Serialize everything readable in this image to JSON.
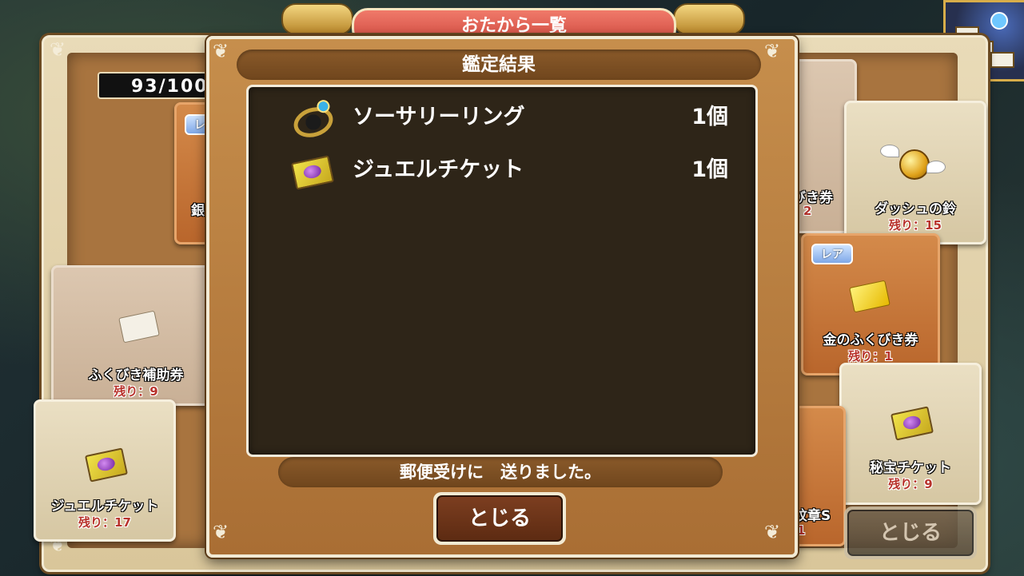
{
  "screen_title": "おたから一覧",
  "inventory_counter": "93/100",
  "background_cards": [
    {
      "name": "ふくびき補助券",
      "remaining_label": "残り：",
      "remaining_value": "9"
    },
    {
      "name": "ジュエルチケット",
      "remaining_label": "残り：",
      "remaining_value": "17"
    },
    {
      "name": "ダッシュの鈴",
      "remaining_label": "残り：",
      "remaining_value": "15"
    },
    {
      "name": "金のふくびき券",
      "remaining_label": "残り：",
      "remaining_value": "1",
      "badge": "レア"
    },
    {
      "name": "秘宝チケット",
      "remaining_label": "残り：",
      "remaining_value": "9"
    }
  ],
  "partial_texts": {
    "left_badge": "レ",
    "left_cut_name": "銀",
    "right_cut_name": "びき券",
    "right_cut_remaining": "2",
    "right_cut_bottom": "紋章S",
    "right_cut_bottom_num": "1"
  },
  "dialog": {
    "title": "鑑定結果",
    "results": [
      {
        "icon": "ring-icon",
        "name": "ソーサリーリング",
        "quantity": "1個"
      },
      {
        "icon": "jewel-ticket-icon",
        "name": "ジュエルチケット",
        "quantity": "1個"
      }
    ],
    "message": "郵便受けに　送りました。",
    "close_label": "とじる"
  },
  "background_close_label": "とじる",
  "colors": {
    "dialog_brown": "#a96e34",
    "list_dark": "#2e2518",
    "remaining_red": "#b8332c",
    "banner_red": "#d04a40"
  }
}
